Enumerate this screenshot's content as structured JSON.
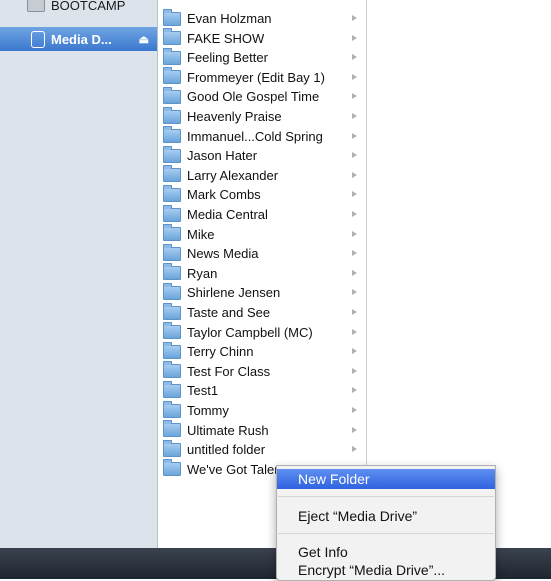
{
  "sidebar": {
    "items": [
      {
        "label": "BOOTCAMP",
        "selected": false
      },
      {
        "label": "Media D...",
        "selected": true
      }
    ]
  },
  "column": {
    "folders": [
      "Evan Holzman",
      "FAKE SHOW",
      "Feeling Better",
      "Frommeyer (Edit Bay 1)",
      "Good Ole Gospel Time",
      "Heavenly Praise",
      "Immanuel...Cold Spring",
      "Jason Hater",
      "Larry Alexander",
      "Mark Combs",
      "Media Central",
      "Mike",
      "News Media",
      "Ryan",
      "Shirlene Jensen",
      "Taste and See",
      "Taylor Campbell (MC)",
      "Terry Chinn",
      "Test For Class",
      "Test1",
      "Tommy",
      "Ultimate Rush",
      "untitled folder",
      "We've Got Talent"
    ]
  },
  "context_menu": {
    "items": [
      {
        "label": "New Folder",
        "highlighted": true
      },
      {
        "label": "Eject “Media Drive”",
        "highlighted": false
      },
      {
        "label": "Get Info",
        "highlighted": false
      },
      {
        "label": "Encrypt “Media Drive”...",
        "highlighted": false
      }
    ]
  },
  "colors": {
    "sidebar_bg": "#dde3ea",
    "selection": "#3b78cf",
    "menu_highlight": "#2f62e0"
  }
}
